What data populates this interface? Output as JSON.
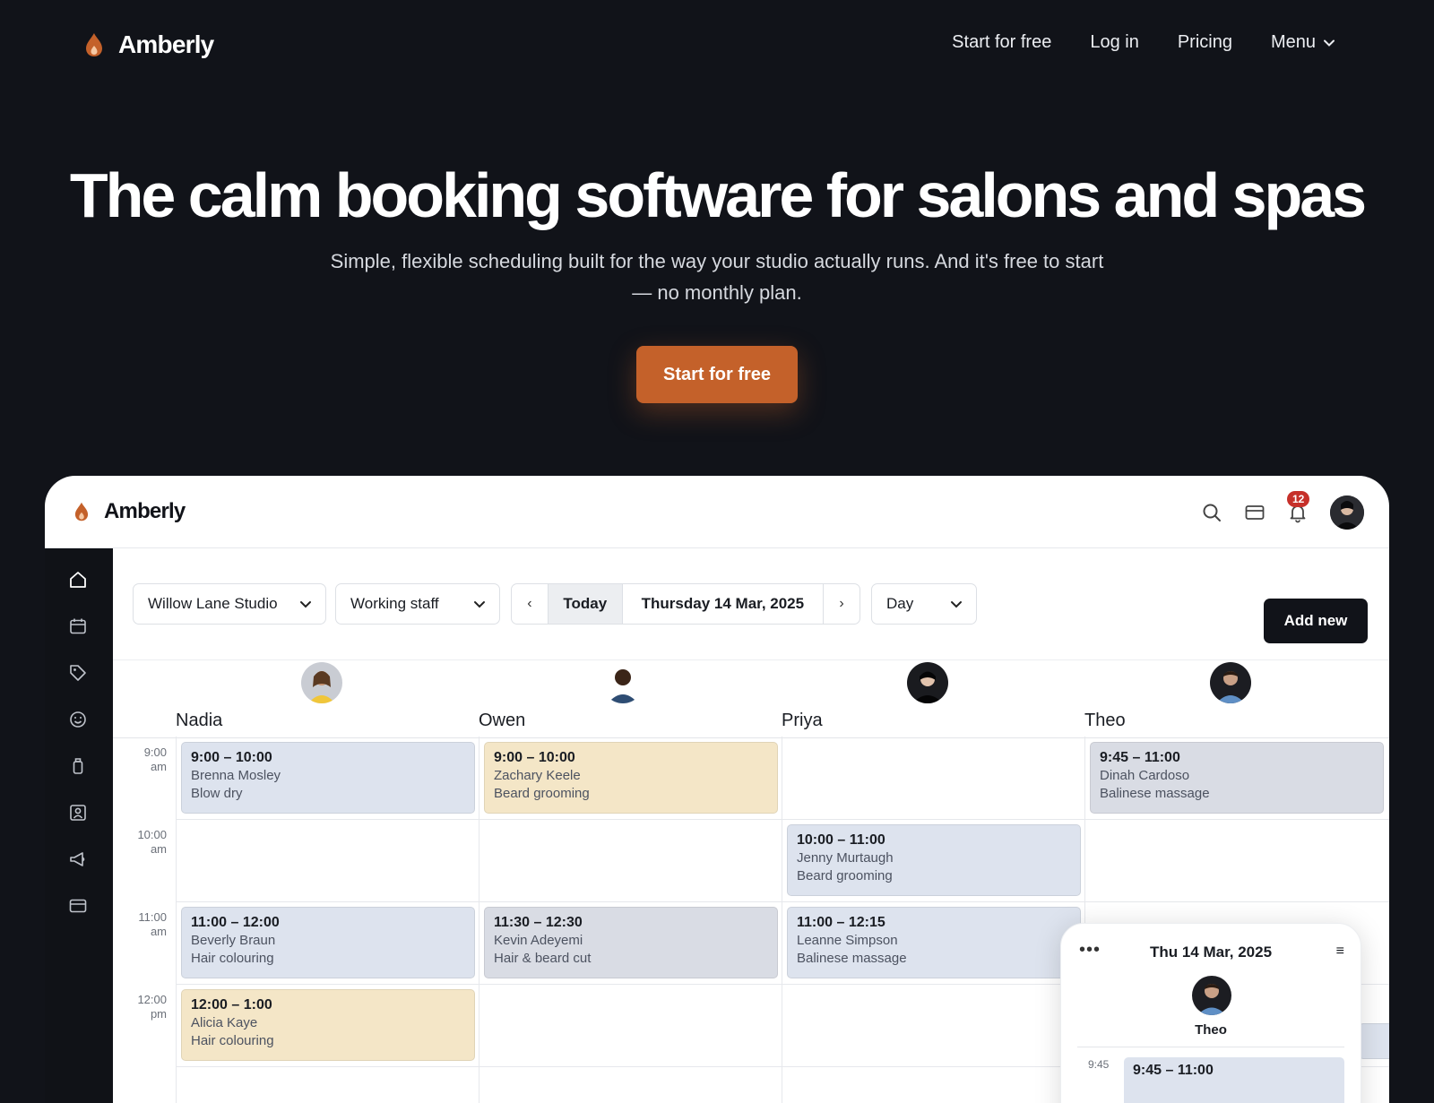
{
  "site": {
    "brand": "Amberly",
    "nav": {
      "start": "Start for free",
      "login": "Log in",
      "pricing": "Pricing",
      "menu": "Menu"
    },
    "hero": {
      "title": "The calm booking software for salons and spas",
      "subtitle": "Simple, flexible scheduling built for the way your studio actually runs. And it's free to start — no monthly plan.",
      "cta": "Start for free"
    },
    "colors": {
      "accent": "#c4612a",
      "dark": "#111319",
      "badge": "#c6302a"
    }
  },
  "app": {
    "brand": "Amberly",
    "notifications": "12",
    "toolbar": {
      "location": "Willow Lane Studio",
      "staff_filter": "Working staff",
      "prev": "‹",
      "today": "Today",
      "date": "Thursday 14 Mar, 2025",
      "next": "›",
      "view": "Day",
      "add_new": "Add new"
    },
    "staff": [
      "Nadia",
      "Owen",
      "Priya",
      "Theo"
    ],
    "times": [
      {
        "h": "9:00",
        "p": "am"
      },
      {
        "h": "10:00",
        "p": "am"
      },
      {
        "h": "11:00",
        "p": "am"
      },
      {
        "h": "12:00",
        "p": "pm"
      }
    ],
    "appointments": [
      {
        "time": "9:00 – 10:00",
        "client": "Brenna Mosley",
        "service": "Blow dry"
      },
      {
        "time": "9:00 – 10:00",
        "client": "Zachary Keele",
        "service": "Beard grooming"
      },
      {
        "time": "9:45 – 11:00",
        "client": "Dinah Cardoso",
        "service": "Balinese massage"
      },
      {
        "time": "10:00 – 11:00",
        "client": "Jenny Murtaugh",
        "service": "Beard grooming"
      },
      {
        "time": "11:00 – 12:00",
        "client": "Beverly Braun",
        "service": "Hair colouring"
      },
      {
        "time": "11:30 – 12:30",
        "client": "Kevin Adeyemi",
        "service": "Hair & beard cut"
      },
      {
        "time": "11:00 – 12:15",
        "client": "Leanne Simpson",
        "service": "Balinese massage"
      },
      {
        "time": "12:00 – 1:00",
        "client": "Alicia Kaye",
        "service": "Hair colouring"
      }
    ],
    "mobile": {
      "date": "Thu 14 Mar, 2025",
      "staff": "Theo",
      "time": "9:45",
      "appt_time": "9:45 – 11:00"
    }
  }
}
